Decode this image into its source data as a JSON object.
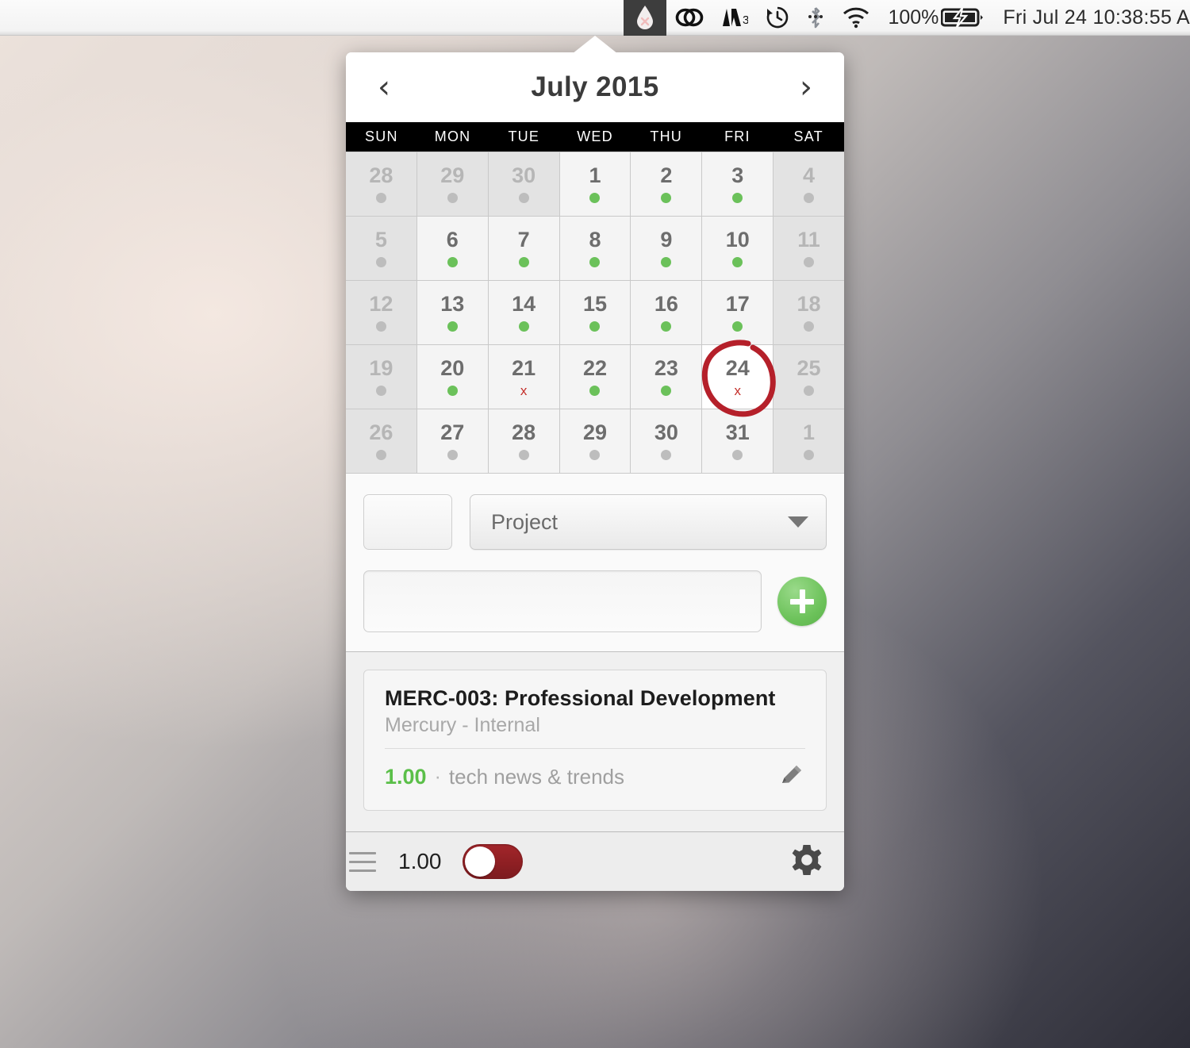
{
  "menubar": {
    "icons": [
      {
        "name": "droplet-icon",
        "glyph": "droplet",
        "selected": true
      },
      {
        "name": "creative-cloud-icon",
        "glyph": "cc",
        "selected": false
      },
      {
        "name": "adobe-icon",
        "glyph": "adobe",
        "selected": false
      },
      {
        "name": "time-machine-icon",
        "glyph": "clock",
        "selected": false
      },
      {
        "name": "bluetooth-icon",
        "glyph": "bluetooth",
        "selected": false
      },
      {
        "name": "wifi-icon",
        "glyph": "wifi",
        "selected": false
      }
    ],
    "battery_percent": "100%",
    "clock": "Fri Jul 24  10:38:55 A"
  },
  "calendar": {
    "prev_label": "‹",
    "next_label": "›",
    "title": "July 2015",
    "weekdays": [
      "SUN",
      "MON",
      "TUE",
      "WED",
      "THU",
      "FRI",
      "SAT"
    ],
    "weeks": [
      [
        {
          "num": "28",
          "state": "muted",
          "marker": "grey-dot"
        },
        {
          "num": "29",
          "state": "muted",
          "marker": "grey-dot"
        },
        {
          "num": "30",
          "state": "muted",
          "marker": "grey-dot"
        },
        {
          "num": "1",
          "state": "normal",
          "marker": "green-dot"
        },
        {
          "num": "2",
          "state": "normal",
          "marker": "green-dot"
        },
        {
          "num": "3",
          "state": "normal",
          "marker": "green-dot"
        },
        {
          "num": "4",
          "state": "muted",
          "marker": "grey-dot"
        }
      ],
      [
        {
          "num": "5",
          "state": "muted",
          "marker": "grey-dot"
        },
        {
          "num": "6",
          "state": "normal",
          "marker": "green-dot"
        },
        {
          "num": "7",
          "state": "normal",
          "marker": "green-dot"
        },
        {
          "num": "8",
          "state": "normal",
          "marker": "green-dot"
        },
        {
          "num": "9",
          "state": "normal",
          "marker": "green-dot"
        },
        {
          "num": "10",
          "state": "normal",
          "marker": "green-dot"
        },
        {
          "num": "11",
          "state": "muted",
          "marker": "grey-dot"
        }
      ],
      [
        {
          "num": "12",
          "state": "muted",
          "marker": "grey-dot"
        },
        {
          "num": "13",
          "state": "normal",
          "marker": "green-dot"
        },
        {
          "num": "14",
          "state": "normal",
          "marker": "green-dot"
        },
        {
          "num": "15",
          "state": "normal",
          "marker": "green-dot"
        },
        {
          "num": "16",
          "state": "normal",
          "marker": "green-dot"
        },
        {
          "num": "17",
          "state": "normal",
          "marker": "green-dot"
        },
        {
          "num": "18",
          "state": "muted",
          "marker": "grey-dot"
        }
      ],
      [
        {
          "num": "19",
          "state": "muted",
          "marker": "grey-dot"
        },
        {
          "num": "20",
          "state": "normal",
          "marker": "green-dot"
        },
        {
          "num": "21",
          "state": "normal",
          "marker": "red-x",
          "marker_text": "x"
        },
        {
          "num": "22",
          "state": "normal",
          "marker": "green-dot"
        },
        {
          "num": "23",
          "state": "normal",
          "marker": "green-dot"
        },
        {
          "num": "24",
          "state": "today",
          "marker": "red-x",
          "marker_text": "x"
        },
        {
          "num": "25",
          "state": "muted",
          "marker": "grey-dot"
        }
      ],
      [
        {
          "num": "26",
          "state": "muted",
          "marker": "grey-dot"
        },
        {
          "num": "27",
          "state": "normal",
          "marker": "grey-dot"
        },
        {
          "num": "28",
          "state": "normal",
          "marker": "grey-dot"
        },
        {
          "num": "29",
          "state": "normal",
          "marker": "grey-dot"
        },
        {
          "num": "30",
          "state": "normal",
          "marker": "grey-dot"
        },
        {
          "num": "31",
          "state": "normal",
          "marker": "grey-dot"
        },
        {
          "num": "1",
          "state": "muted",
          "marker": "grey-dot"
        }
      ]
    ],
    "annotation": {
      "type": "red-circle",
      "around_day": "24"
    }
  },
  "form": {
    "hours_value": "",
    "hours_placeholder": "",
    "project_label": "Project",
    "note_value": "",
    "note_placeholder": "",
    "add_label": "+"
  },
  "entries": [
    {
      "title": "MERC-003: Professional Development",
      "subtitle": "Mercury - Internal",
      "hours": "1.00",
      "separator": "·",
      "note": "tech news & trends",
      "edit_icon": "pencil-icon"
    }
  ],
  "footer": {
    "menu_icon": "hamburger-icon",
    "total": "1.00",
    "timer_on": false,
    "settings_icon": "gear-icon"
  },
  "colors": {
    "accent_green": "#6bc15a",
    "accent_red": "#8e1f23",
    "marker_red": "#c4302b",
    "header_black": "#000000"
  }
}
